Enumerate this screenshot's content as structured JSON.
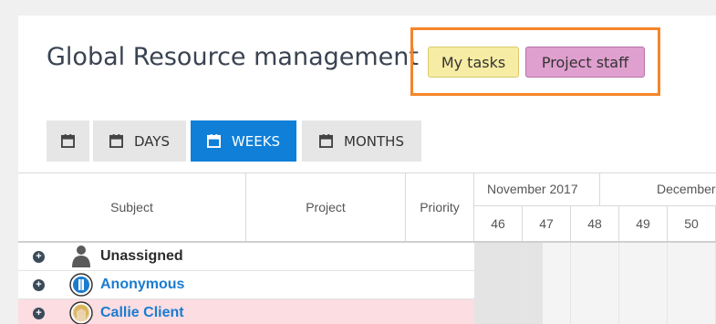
{
  "header": {
    "title": "Global Resource management",
    "chips": [
      {
        "label": "My tasks",
        "color": "#f7eca4"
      },
      {
        "label": "Project staff",
        "color": "#df9fcf"
      }
    ]
  },
  "toolbar": {
    "calendar_icon": "calendar-icon",
    "days_label": "DAYS",
    "weeks_label": "WEEKS",
    "months_label": "MONTHS",
    "active": "WEEKS"
  },
  "table": {
    "columns": [
      "Subject",
      "Project",
      "Priority"
    ],
    "months": [
      "November 2017",
      "December"
    ],
    "weeks": [
      "46",
      "47",
      "48",
      "49",
      "50"
    ],
    "rows": [
      {
        "name": "Unassigned",
        "icon": "user-silhouette-icon"
      },
      {
        "name": "Anonymous",
        "icon": "anonymous-avatar"
      },
      {
        "name": "Callie Client",
        "icon": "user-photo-avatar"
      }
    ]
  },
  "colors": {
    "accent": "#0f7fd8",
    "highlight_border": "#f5852a",
    "row_highlight": "#fbdde2"
  }
}
